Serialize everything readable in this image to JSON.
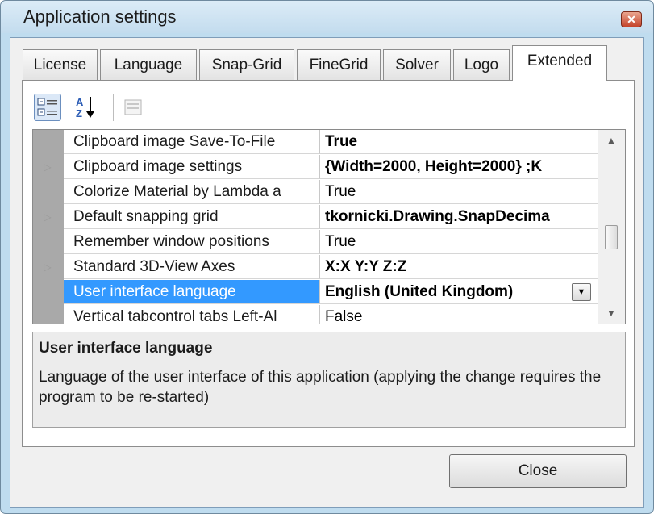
{
  "window": {
    "title": "Application settings"
  },
  "tabs": [
    {
      "label": "License",
      "active": false
    },
    {
      "label": "Language",
      "active": false
    },
    {
      "label": "Snap-Grid",
      "active": false
    },
    {
      "label": "FineGrid",
      "active": false
    },
    {
      "label": "Solver",
      "active": false
    },
    {
      "label": "Logo",
      "active": false
    },
    {
      "label": "Extended",
      "active": true
    }
  ],
  "toolbar": {
    "categorized_icon": "categorized-view-icon",
    "alphabetical_icon": "sort-alphabetical-icon",
    "property_pages_icon": "property-pages-icon"
  },
  "properties": [
    {
      "name": "Clipboard image Save-To-File",
      "value": "True",
      "bold": true,
      "expandable": false
    },
    {
      "name": "Clipboard image settings",
      "value": "{Width=2000, Height=2000} ;K",
      "bold": true,
      "expandable": true
    },
    {
      "name": "Colorize Material by Lambda a",
      "value": "True",
      "bold": false,
      "expandable": false
    },
    {
      "name": "Default snapping grid",
      "value": "tkornicki.Drawing.SnapDecima",
      "bold": true,
      "expandable": true
    },
    {
      "name": "Remember window positions",
      "value": "True",
      "bold": false,
      "expandable": false
    },
    {
      "name": "Standard 3D-View Axes",
      "value": "X:X Y:Y Z:Z",
      "bold": true,
      "expandable": true
    },
    {
      "name": "User interface language",
      "value": "English (United Kingdom)",
      "bold": true,
      "expandable": false,
      "selected": true
    },
    {
      "name": "Vertical tabcontrol tabs Left-Al",
      "value": "False",
      "bold": false,
      "expandable": false
    }
  ],
  "help": {
    "title": "User interface language",
    "description": "Language of the user interface of this application (applying the change requires the program to be re-started)"
  },
  "buttons": {
    "close": "Close"
  },
  "colors": {
    "selection": "#3399ff",
    "gutter": "#a9a9a9",
    "window_frame": "#bfdcef"
  }
}
